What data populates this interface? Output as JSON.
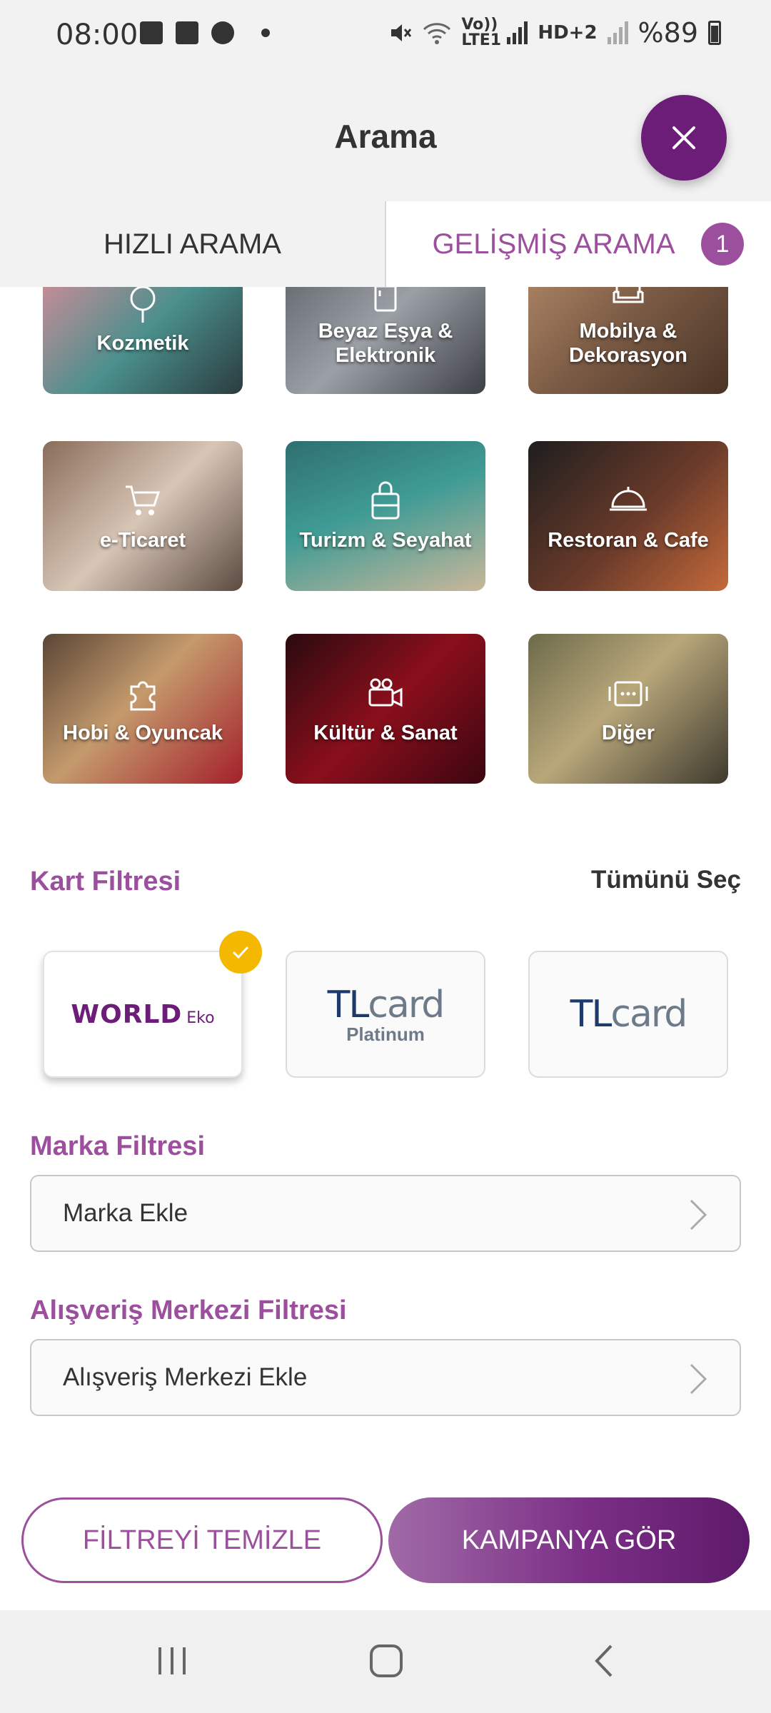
{
  "status_bar": {
    "time": "08:00",
    "icons": [
      "image-icon",
      "ge-icon",
      "music-icon",
      "dot-icon",
      "mute-icon",
      "wifi-icon",
      "signal-icon",
      "battery-icon"
    ],
    "network_label": "Vo)) LTE1",
    "hd_label": "HD+2",
    "battery_text": "%89"
  },
  "header": {
    "title": "Arama",
    "close_icon": "close-icon",
    "accent_color": "#6b1d78"
  },
  "tabs": [
    {
      "label": "HIZLI ARAMA",
      "active": false
    },
    {
      "label": "GELİŞMİŞ ARAMA",
      "active": true,
      "badge": "1"
    }
  ],
  "categories": [
    {
      "label": "Kozmetik",
      "icon": "mirror-icon"
    },
    {
      "label": "Beyaz Eşya &\nElektronik",
      "icon": "fridge-icon"
    },
    {
      "label": "Mobilya &\nDekorasyon",
      "icon": "sofa-icon"
    },
    {
      "label": "e-Ticaret",
      "icon": "cart-icon"
    },
    {
      "label": "Turizm & Seyahat",
      "icon": "luggage-icon"
    },
    {
      "label": "Restoran & Cafe",
      "icon": "dish-icon"
    },
    {
      "label": "Hobi & Oyuncak",
      "icon": "puzzle-icon"
    },
    {
      "label": "Kültür & Sanat",
      "icon": "camera-icon"
    },
    {
      "label": "Diğer",
      "icon": "more-icon"
    }
  ],
  "card_filter": {
    "title": "Kart Filtresi",
    "select_all": "Tümünü Seç",
    "cards": [
      {
        "brand": "WORLD",
        "sub": "Eko",
        "selected": true
      },
      {
        "brand_a": "TL",
        "brand_b": "card",
        "sub": "Platinum",
        "selected": false
      },
      {
        "brand_a": "TL",
        "brand_b": "card",
        "selected": false
      }
    ]
  },
  "brand_filter": {
    "title": "Marka Filtresi",
    "field_label": "Marka Ekle"
  },
  "mall_filter": {
    "title": "Alışveriş Merkezi Filtresi",
    "field_label": "Alışveriş Merkezi Ekle"
  },
  "actions": {
    "clear_label": "FİLTREYİ TEMİZLE",
    "go_label": "KAMPANYA GÖR"
  },
  "nav": {
    "icons": [
      "recent-apps-icon",
      "home-icon",
      "back-icon"
    ]
  }
}
